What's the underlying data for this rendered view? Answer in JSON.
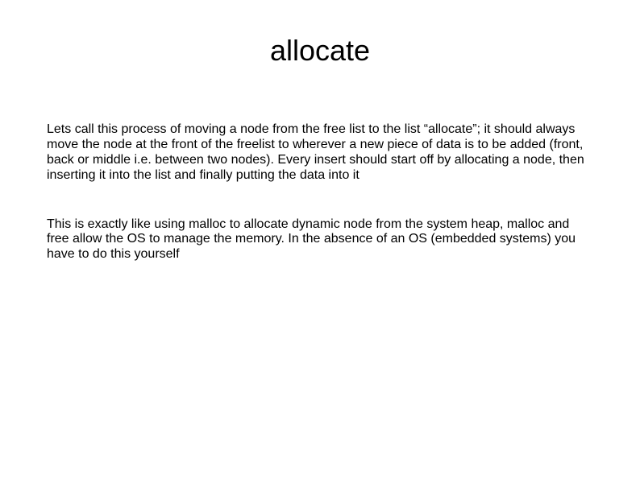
{
  "title": "allocate",
  "paragraphs": {
    "p1": "Lets call this process of moving a node from the free list to the list “allocate”; it should always move the node at the front of the freelist to wherever a new piece of data is to be added (front, back or middle i.e. between two nodes). Every insert should start off by allocating a node, then inserting it into the list and finally putting the data into it",
    "p2": "This is exactly like using malloc to allocate dynamic  node from the system heap, malloc and free allow the OS to manage the memory.  In the absence of an OS (embedded systems) you have to do this yourself"
  }
}
